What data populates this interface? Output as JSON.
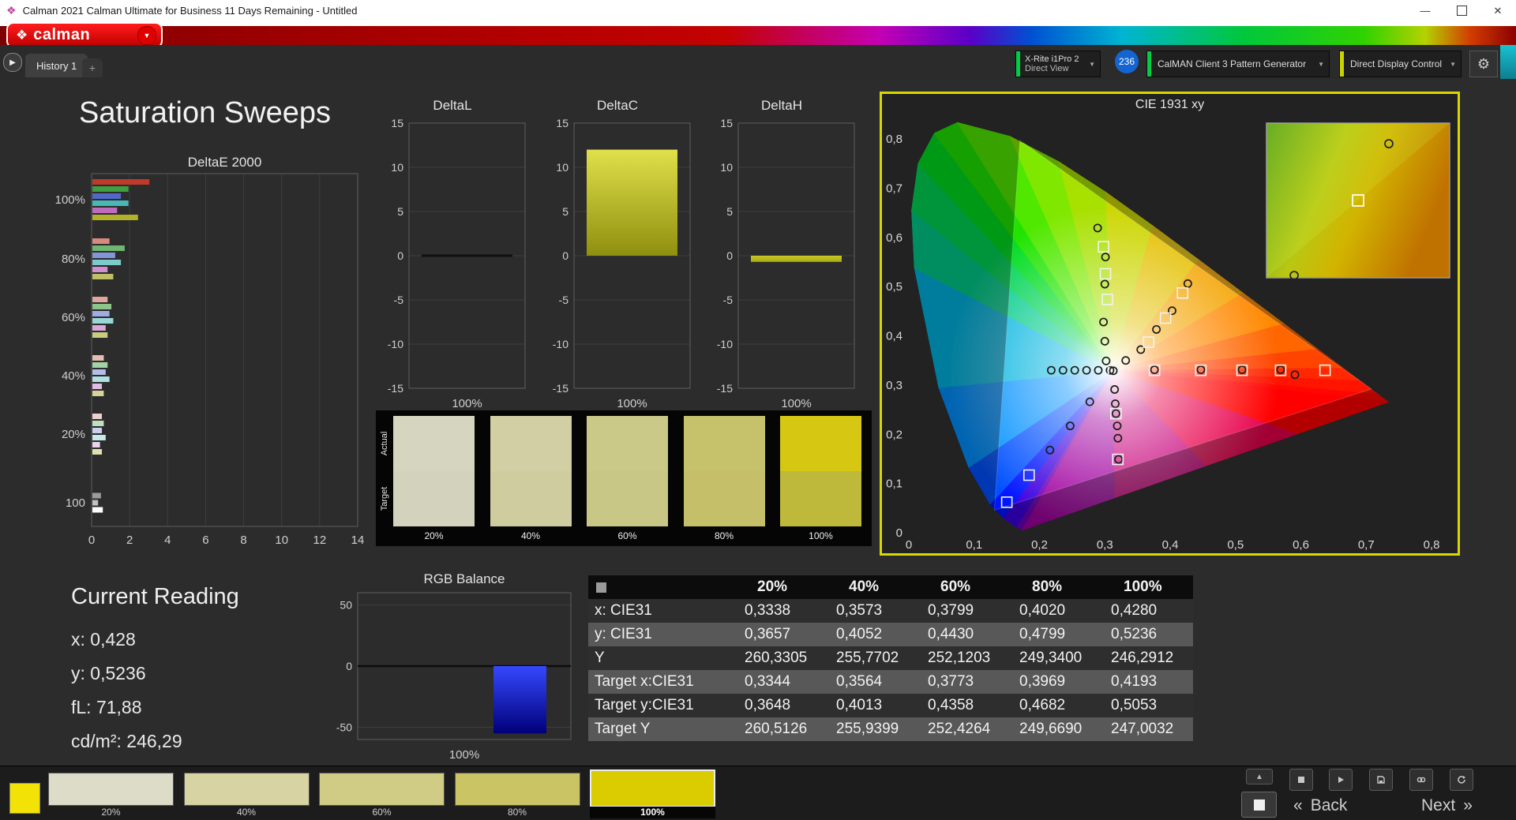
{
  "window": {
    "title": "Calman 2021 Calman Ultimate for Business 11 Days Remaining  - Untitled"
  },
  "header": {
    "logo_text": "calman"
  },
  "tabs": {
    "history_tab": "History 1"
  },
  "devices": {
    "meter": {
      "line1": "X-Rite i1Pro 2",
      "line2": "Direct View",
      "accent": "#00cc44"
    },
    "badge": "236",
    "pattern_generator": "CalMAN Client 3 Pattern Generator",
    "pattern_accent": "#00cc44",
    "display_control": "Direct Display Control",
    "display_accent": "#c8d400"
  },
  "icons": {
    "gear": "⚙",
    "dropdown": "▼",
    "play_tab": "▶",
    "plus": "+",
    "logo_star": "❖",
    "titlebar_logo": "❖",
    "minimize": "—",
    "close": "✕",
    "back_chevrons": "«",
    "next_chevrons": "»",
    "chevron_up": "▲"
  },
  "page": {
    "title": "Saturation Sweeps"
  },
  "current_reading": {
    "heading": "Current Reading",
    "x": "x: 0,428",
    "y": "y: 0,5236",
    "fl": "fL: 71,88",
    "cdm2": "cd/m²: 246,29"
  },
  "swatch_strip": {
    "row_labels": [
      "Actual",
      "Target"
    ],
    "columns": [
      {
        "label": "20%",
        "actual": "#d5d5c0",
        "target": "#d3d3bd"
      },
      {
        "label": "40%",
        "actual": "#d1cfa3",
        "target": "#cfcda0"
      },
      {
        "label": "60%",
        "actual": "#cbc988",
        "target": "#c9c785"
      },
      {
        "label": "80%",
        "actual": "#c6c16b",
        "target": "#c4bf68"
      },
      {
        "label": "100%",
        "actual": "#d6c713",
        "target": "#beb93a"
      }
    ]
  },
  "table": {
    "headers": [
      "20%",
      "40%",
      "60%",
      "80%",
      "100%"
    ],
    "rows": [
      {
        "label": "x: CIE31",
        "values": [
          "0,3338",
          "0,3573",
          "0,3799",
          "0,4020",
          "0,4280"
        ]
      },
      {
        "label": "y: CIE31",
        "values": [
          "0,3657",
          "0,4052",
          "0,4430",
          "0,4799",
          "0,5236"
        ]
      },
      {
        "label": "Y",
        "values": [
          "260,3305",
          "255,7702",
          "252,1203",
          "249,3400",
          "246,2912"
        ]
      },
      {
        "label": "Target x:CIE31",
        "values": [
          "0,3344",
          "0,3564",
          "0,3773",
          "0,3969",
          "0,4193"
        ]
      },
      {
        "label": "Target y:CIE31",
        "values": [
          "0,3648",
          "0,4013",
          "0,4358",
          "0,4682",
          "0,5053"
        ]
      },
      {
        "label": "Target Y",
        "values": [
          "260,5126",
          "255,9399",
          "252,4264",
          "249,6690",
          "247,0032"
        ]
      }
    ]
  },
  "bottom_bar": {
    "selected": "100%",
    "swatches": [
      {
        "label": "20%",
        "color": "#dcdcc8"
      },
      {
        "label": "40%",
        "color": "#d7d3a2"
      },
      {
        "label": "60%",
        "color": "#d0cb85"
      },
      {
        "label": "80%",
        "color": "#cbc465"
      },
      {
        "label": "100%",
        "color": "#dacc00"
      }
    ],
    "back": "Back",
    "next": "Next"
  },
  "chart_data": [
    {
      "id": "deltaE2000",
      "type": "bar",
      "orientation": "horizontal",
      "title": "DeltaE 2000",
      "xlim": [
        0,
        14
      ],
      "xticks": [
        0,
        2,
        4,
        6,
        8,
        10,
        12,
        14
      ],
      "groups": [
        {
          "label": "100%",
          "bars": [
            {
              "c": "#c03a2c",
              "v": 3.0
            },
            {
              "c": "#3f9e3f",
              "v": 1.9
            },
            {
              "c": "#5168c8",
              "v": 1.5
            },
            {
              "c": "#4ab6b6",
              "v": 1.9
            },
            {
              "c": "#bf6cbf",
              "v": 1.3
            },
            {
              "c": "#b2b22a",
              "v": 2.4
            }
          ]
        },
        {
          "label": "80%",
          "bars": [
            {
              "c": "#d88a7f",
              "v": 0.9
            },
            {
              "c": "#6fb66f",
              "v": 1.7
            },
            {
              "c": "#8496da",
              "v": 1.2
            },
            {
              "c": "#7ccaca",
              "v": 1.5
            },
            {
              "c": "#d090d0",
              "v": 0.8
            },
            {
              "c": "#bfbf66",
              "v": 1.1
            }
          ]
        },
        {
          "label": "60%",
          "bars": [
            {
              "c": "#dfa79c",
              "v": 0.8
            },
            {
              "c": "#8cc48c",
              "v": 1.0
            },
            {
              "c": "#9fabe2",
              "v": 0.9
            },
            {
              "c": "#99d6d6",
              "v": 1.1
            },
            {
              "c": "#dba7db",
              "v": 0.7
            },
            {
              "c": "#caca80",
              "v": 0.8
            }
          ]
        },
        {
          "label": "40%",
          "bars": [
            {
              "c": "#e5bdb4",
              "v": 0.6
            },
            {
              "c": "#a5d2a5",
              "v": 0.8
            },
            {
              "c": "#b4bde9",
              "v": 0.7
            },
            {
              "c": "#b0e0e0",
              "v": 0.9
            },
            {
              "c": "#e3bce3",
              "v": 0.5
            },
            {
              "c": "#d5d59a",
              "v": 0.6
            }
          ]
        },
        {
          "label": "20%",
          "bars": [
            {
              "c": "#ecd2cc",
              "v": 0.5
            },
            {
              "c": "#bfdfbf",
              "v": 0.6
            },
            {
              "c": "#c9cfef",
              "v": 0.5
            },
            {
              "c": "#c7e9e9",
              "v": 0.7
            },
            {
              "c": "#ecd2ec",
              "v": 0.4
            },
            {
              "c": "#e0e0b4",
              "v": 0.5
            }
          ]
        },
        {
          "label": "100",
          "bars": [
            {
              "c": "#9c9c9c",
              "v": 0.45
            },
            {
              "c": "#c2c2c2",
              "v": 0.3
            },
            {
              "c": "#ffffff",
              "v": 0.55
            }
          ]
        }
      ]
    },
    {
      "id": "deltaL",
      "type": "bar",
      "title": "DeltaL",
      "ylim": [
        -15,
        15
      ],
      "yticks": [
        15,
        10,
        5,
        0,
        -5,
        -10,
        -15
      ],
      "xlabel": "100%",
      "value": 0,
      "c1": "#141414",
      "c2": "#141414"
    },
    {
      "id": "deltaC",
      "type": "bar",
      "title": "DeltaC",
      "ylim": [
        -15,
        15
      ],
      "yticks": [
        15,
        10,
        5,
        0,
        -5,
        -10,
        -15
      ],
      "xlabel": "100%",
      "value": 12,
      "c1": "#e0e04a",
      "c2": "#8f8f10"
    },
    {
      "id": "deltaH",
      "type": "bar",
      "title": "DeltaH",
      "ylim": [
        -15,
        15
      ],
      "yticks": [
        15,
        10,
        5,
        0,
        -5,
        -10,
        -15
      ],
      "xlabel": "100%",
      "value": -0.7,
      "c1": "#c9c922",
      "c2": "#a8a818"
    },
    {
      "id": "rgbBalance",
      "type": "bar",
      "title": "RGB Balance",
      "ylim": [
        -60,
        60
      ],
      "yticks": [
        50,
        0,
        -50
      ],
      "xlabel": "100%",
      "bars": [
        {
          "v": -55,
          "c1": "#3548ff",
          "c2": "#000078"
        }
      ]
    },
    {
      "id": "cie",
      "type": "scatter",
      "title": "CIE 1931 xy",
      "tick_labels": [
        "0",
        "0,1",
        "0,2",
        "0,3",
        "0,4",
        "0,5",
        "0,6",
        "0,7",
        "0,8"
      ],
      "tick_values": [
        0,
        0.1,
        0.2,
        0.3,
        0.4,
        0.5,
        0.6,
        0.7,
        0.8
      ],
      "white_point": [
        0.3127,
        0.329
      ],
      "gamut_triangle": [
        [
          0.708,
          0.292
        ],
        [
          0.17,
          0.797
        ],
        [
          0.131,
          0.046
        ]
      ],
      "target_squares": [
        [
          0.313,
          0.329
        ],
        [
          0.376,
          0.33
        ],
        [
          0.447,
          0.33
        ],
        [
          0.51,
          0.33
        ],
        [
          0.569,
          0.33
        ],
        [
          0.637,
          0.33
        ],
        [
          0.298,
          0.581
        ],
        [
          0.301,
          0.526
        ],
        [
          0.304,
          0.474
        ],
        [
          0.317,
          0.242
        ],
        [
          0.32,
          0.149
        ],
        [
          0.184,
          0.117
        ],
        [
          0.15,
          0.062
        ],
        [
          0.419,
          0.487
        ],
        [
          0.393,
          0.436
        ],
        [
          0.367,
          0.387
        ]
      ],
      "measured_circles": [
        [
          0.218,
          0.33
        ],
        [
          0.236,
          0.33
        ],
        [
          0.254,
          0.33
        ],
        [
          0.272,
          0.33
        ],
        [
          0.29,
          0.33
        ],
        [
          0.308,
          0.33
        ],
        [
          0.313,
          0.329
        ],
        [
          0.376,
          0.331
        ],
        [
          0.447,
          0.331
        ],
        [
          0.51,
          0.331
        ],
        [
          0.569,
          0.331
        ],
        [
          0.591,
          0.321
        ],
        [
          0.289,
          0.619
        ],
        [
          0.301,
          0.56
        ],
        [
          0.3,
          0.505
        ],
        [
          0.298,
          0.428
        ],
        [
          0.3,
          0.389
        ],
        [
          0.302,
          0.349
        ],
        [
          0.315,
          0.291
        ],
        [
          0.316,
          0.262
        ],
        [
          0.317,
          0.242
        ],
        [
          0.319,
          0.217
        ],
        [
          0.32,
          0.192
        ],
        [
          0.321,
          0.149
        ],
        [
          0.216,
          0.168
        ],
        [
          0.247,
          0.217
        ],
        [
          0.277,
          0.266
        ],
        [
          0.427,
          0.506
        ],
        [
          0.403,
          0.451
        ],
        [
          0.379,
          0.413
        ],
        [
          0.355,
          0.372
        ],
        [
          0.332,
          0.35
        ]
      ],
      "inset": {
        "square": [
          0.5,
          0.5
        ],
        "circles": [
          [
            0.668,
            0.133
          ],
          [
            0.151,
            0.985
          ]
        ]
      }
    }
  ]
}
